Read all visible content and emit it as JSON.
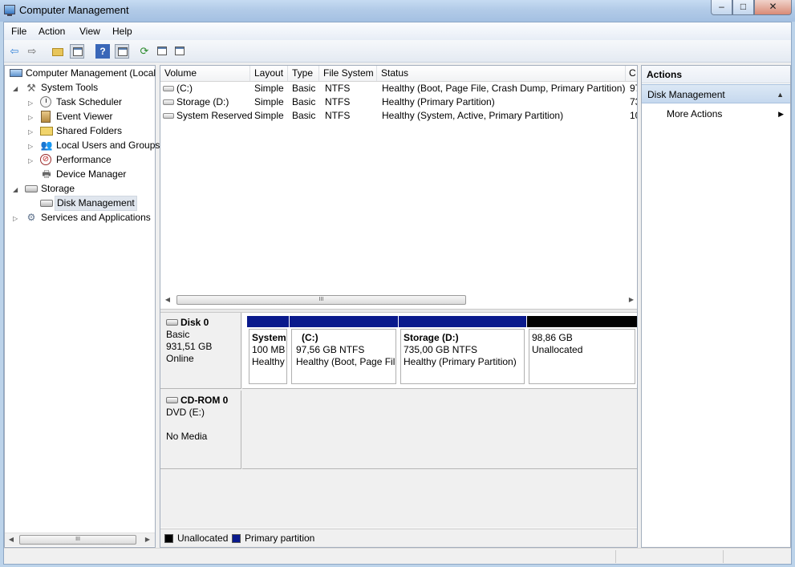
{
  "window": {
    "title": "Computer Management",
    "minimize_glyph": "‒",
    "maximize_glyph": "□",
    "close_glyph": "✕"
  },
  "menu": {
    "items": [
      {
        "label": "File"
      },
      {
        "label": "Action"
      },
      {
        "label": "View"
      },
      {
        "label": "Help"
      }
    ]
  },
  "toolbar": {
    "icons": [
      "back-arrow-icon",
      "forward-arrow-icon",
      "up-folder-icon",
      "show-console-tree-icon",
      "help-icon",
      "show-action-pane-icon",
      "refresh-icon",
      "properties-icon",
      "export-list-icon"
    ],
    "back_glyph": "⇦",
    "forward_glyph": "⇨",
    "help_glyph": "?",
    "refresh_glyph": "⟳"
  },
  "tree": {
    "items": [
      {
        "label": "Computer Management (Local",
        "icon": "computer-icon",
        "expander": ""
      },
      {
        "label": "System Tools",
        "icon": "tools-icon",
        "expander": "◢"
      },
      {
        "label": "Task Scheduler",
        "icon": "clock-icon",
        "expander": "▷"
      },
      {
        "label": "Event Viewer",
        "icon": "event-log-icon",
        "expander": "▷"
      },
      {
        "label": "Shared Folders",
        "icon": "shared-folder-icon",
        "expander": "▷"
      },
      {
        "label": "Local Users and Groups",
        "icon": "users-icon",
        "expander": "▷"
      },
      {
        "label": "Performance",
        "icon": "performance-icon",
        "expander": "▷"
      },
      {
        "label": "Device Manager",
        "icon": "device-manager-icon",
        "expander": ""
      },
      {
        "label": "Storage",
        "icon": "storage-icon",
        "expander": "◢"
      },
      {
        "label": "Disk Management",
        "icon": "disk-management-icon",
        "expander": ""
      },
      {
        "label": "Services and Applications",
        "icon": "services-icon",
        "expander": "▷"
      }
    ],
    "selected": "Disk Management"
  },
  "volume_list": {
    "columns": [
      "Volume",
      "Layout",
      "Type",
      "File System",
      "Status",
      "C"
    ],
    "rows": [
      {
        "volume": "(C:)",
        "layout": "Simple",
        "type": "Basic",
        "fs": "NTFS",
        "status": "Healthy (Boot, Page File, Crash Dump, Primary Partition)",
        "c": "97"
      },
      {
        "volume": "Storage (D:)",
        "layout": "Simple",
        "type": "Basic",
        "fs": "NTFS",
        "status": "Healthy (Primary Partition)",
        "c": "73"
      },
      {
        "volume": "System Reserved",
        "layout": "Simple",
        "type": "Basic",
        "fs": "NTFS",
        "status": "Healthy (System, Active, Primary Partition)",
        "c": "10"
      }
    ],
    "scroll_thumb_glyph": "III"
  },
  "disks": [
    {
      "name": "Disk 0",
      "type": "Basic",
      "size": "931,51 GB",
      "state": "Online",
      "partitions": [
        {
          "title": "System",
          "size": "100 MB",
          "status": "Healthy",
          "bar_color": "#0a1a8c"
        },
        {
          "title": "(C:)",
          "size": "97,56 GB NTFS",
          "status": "Healthy (Boot, Page Fil",
          "bar_color": "#0a1a8c"
        },
        {
          "title": "Storage  (D:)",
          "size": "735,00 GB NTFS",
          "status": "Healthy (Primary Partition)",
          "bar_color": "#0a1a8c"
        },
        {
          "title": "",
          "size": "98,86 GB",
          "status": "Unallocated",
          "bar_color": "#000000"
        }
      ]
    },
    {
      "name": "CD-ROM 0",
      "type": "DVD (E:)",
      "size": "",
      "state": "No Media",
      "partitions": []
    }
  ],
  "legend": [
    {
      "label": "Unallocated",
      "color": "#000000"
    },
    {
      "label": "Primary partition",
      "color": "#0a1a8c"
    }
  ],
  "actions": {
    "header": "Actions",
    "section": "Disk Management",
    "section_caret": "▲",
    "items": [
      {
        "label": "More Actions",
        "caret": "▶"
      }
    ]
  },
  "tree_scroll": {
    "thumb_glyph": "III",
    "left_glyph": "◀",
    "right_glyph": "▶"
  }
}
